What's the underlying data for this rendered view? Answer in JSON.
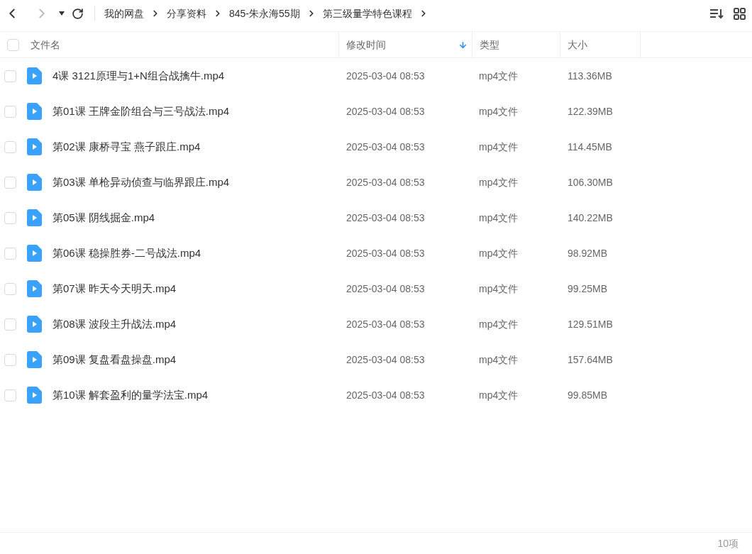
{
  "breadcrumb": [
    "我的网盘",
    "分享资料",
    "845-朱永海55期",
    "第三级量学特色课程"
  ],
  "select_all": {
    "checked": false
  },
  "columns": [
    {
      "label": "文件名",
      "sorted": false
    },
    {
      "label": "修改时间",
      "sorted": true
    },
    {
      "label": "类型",
      "sorted": false
    },
    {
      "label": "大小",
      "sorted": false
    }
  ],
  "rows": [
    {
      "name": "4课 3121原理与1+N组合战擒牛.mp4",
      "modified": "2025-03-04 08:53",
      "type": "mp4文件",
      "size": "113.36MB",
      "checked": false
    },
    {
      "name": "第01课 王牌金阶组合与三号战法.mp4",
      "modified": "2025-03-04 08:53",
      "type": "mp4文件",
      "size": "122.39MB",
      "checked": false
    },
    {
      "name": "第02课 康桥寻宝 燕子跟庄.mp4",
      "modified": "2025-03-04 08:53",
      "type": "mp4文件",
      "size": "114.45MB",
      "checked": false
    },
    {
      "name": "第03课 单枪异动侦查与临界跟庄.mp4",
      "modified": "2025-03-04 08:53",
      "type": "mp4文件",
      "size": "106.30MB",
      "checked": false
    },
    {
      "name": "第05课 阴线掘金.mp4",
      "modified": "2025-03-04 08:53",
      "type": "mp4文件",
      "size": "140.22MB",
      "checked": false
    },
    {
      "name": "第06课 稳操胜券-二号战法.mp4",
      "modified": "2025-03-04 08:53",
      "type": "mp4文件",
      "size": "98.92MB",
      "checked": false
    },
    {
      "name": "第07课 昨天今天明天.mp4",
      "modified": "2025-03-04 08:53",
      "type": "mp4文件",
      "size": "99.25MB",
      "checked": false
    },
    {
      "name": "第08课 波段主升战法.mp4",
      "modified": "2025-03-04 08:53",
      "type": "mp4文件",
      "size": "129.51MB",
      "checked": false
    },
    {
      "name": "第09课 复盘看盘操盘.mp4",
      "modified": "2025-03-04 08:53",
      "type": "mp4文件",
      "size": "157.64MB",
      "checked": false
    },
    {
      "name": "第10课 解套盈利的量学法宝.mp4",
      "modified": "2025-03-04 08:53",
      "type": "mp4文件",
      "size": "99.85MB",
      "checked": false
    }
  ],
  "status_bar": {
    "count": "10项"
  }
}
